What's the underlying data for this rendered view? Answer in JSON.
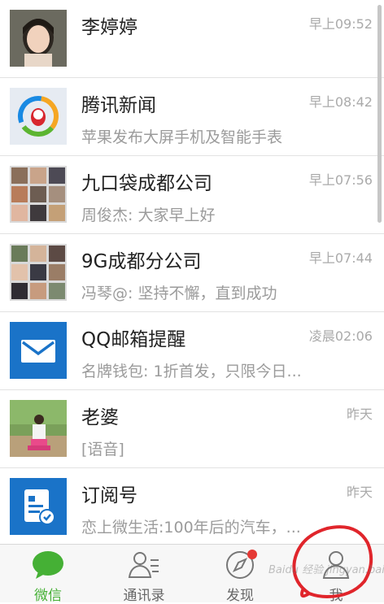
{
  "conversations": [
    {
      "name": "李婷婷",
      "message": "",
      "time": "早上09:52",
      "avatar": "photo-woman"
    },
    {
      "name": "腾讯新闻",
      "message": "苹果发布大屏手机及智能手表",
      "time": "早上08:42",
      "avatar": "tencent-news-logo"
    },
    {
      "name": "九口袋成都公司",
      "message": "周俊杰: 大家早上好",
      "time": "早上07:56",
      "avatar": "group-photo-grid"
    },
    {
      "name": "9G成都分公司",
      "message": "冯琴@: 坚持不懈，直到成功",
      "time": "早上07:44",
      "avatar": "group-photo-grid"
    },
    {
      "name": "QQ邮箱提醒",
      "message": "名牌钱包: 1折首发，只限今日...",
      "time": "凌晨02:06",
      "avatar": "mail-icon"
    },
    {
      "name": "老婆",
      "message": "[语音]",
      "time": "昨天",
      "avatar": "photo-outdoor"
    },
    {
      "name": "订阅号",
      "message": "恋上微生活:100年后的汽车，...",
      "time": "昨天",
      "avatar": "subscription-icon"
    }
  ],
  "tabs": [
    {
      "label": "微信",
      "icon": "chat-bubble-icon",
      "active": true
    },
    {
      "label": "通讯录",
      "icon": "contacts-icon",
      "active": false
    },
    {
      "label": "发现",
      "icon": "compass-icon",
      "active": false,
      "badge": true
    },
    {
      "label": "我",
      "icon": "person-icon",
      "active": false
    }
  ],
  "watermark": "Baidu 经验 jingyan.baidu.com",
  "colors": {
    "accent": "#45b035",
    "badge": "#e53935",
    "mail_blue": "#1a73c8",
    "annotation": "#e0252b"
  }
}
